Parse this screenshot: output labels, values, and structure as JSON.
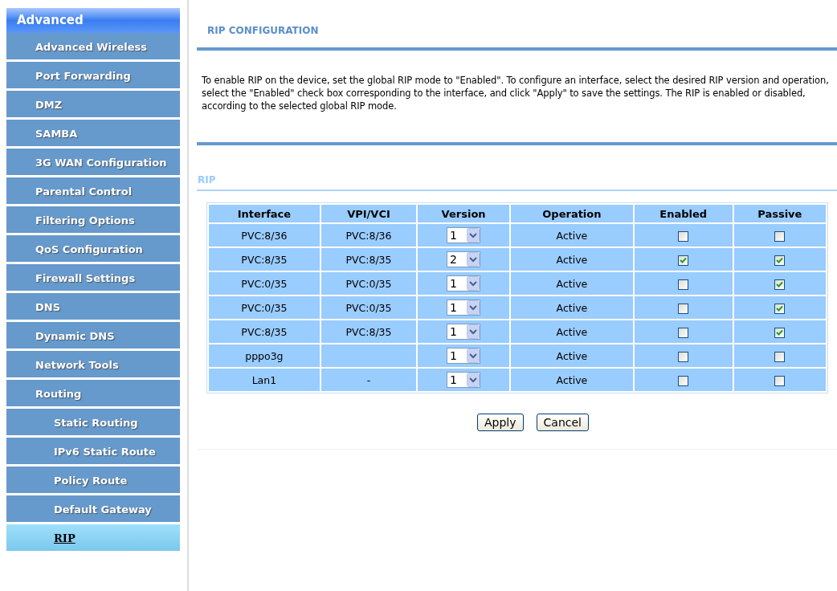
{
  "sidebar": {
    "header": "Advanced",
    "items": [
      {
        "label": "Advanced Wireless",
        "selected": false
      },
      {
        "label": "Port Forwarding",
        "selected": false
      },
      {
        "label": "DMZ",
        "selected": false
      },
      {
        "label": "SAMBA",
        "selected": false
      },
      {
        "label": "3G WAN Configuration",
        "selected": false
      },
      {
        "label": "Parental Control",
        "selected": false
      },
      {
        "label": "Filtering Options",
        "selected": false
      },
      {
        "label": "QoS Configuration",
        "selected": false
      },
      {
        "label": "Firewall Settings",
        "selected": false
      },
      {
        "label": "DNS",
        "selected": false
      },
      {
        "label": "Dynamic DNS",
        "selected": false
      },
      {
        "label": "Network Tools",
        "selected": false
      },
      {
        "label": "Routing",
        "selected": false,
        "children": [
          {
            "label": "Static Routing",
            "selected": false
          },
          {
            "label": "IPv6 Static Route",
            "selected": false
          },
          {
            "label": "Policy Route",
            "selected": false
          },
          {
            "label": "Default Gateway",
            "selected": false
          },
          {
            "label": "RIP",
            "selected": true
          }
        ]
      }
    ]
  },
  "main": {
    "title": "RIP CONFIGURATION",
    "description": "To enable RIP on the device, set the global RIP mode to \"Enabled\". To configure an interface, select the desired RIP version and operation, select the \"Enabled\" check box corresponding to the interface, and click \"Apply\" to save the settings. The RIP is enabled or disabled, according to the selected global RIP mode.",
    "section": "RIP",
    "table": {
      "columns": [
        "Interface",
        "VPI/VCI",
        "Version",
        "Operation",
        "Enabled",
        "Passive"
      ],
      "rows": [
        {
          "interface": "PVC:8/36",
          "vpi_vci": "PVC:8/36",
          "version": "1",
          "operation": "Active",
          "enabled": false,
          "passive": false
        },
        {
          "interface": "PVC:8/35",
          "vpi_vci": "PVC:8/35",
          "version": "2",
          "operation": "Active",
          "enabled": true,
          "passive": true
        },
        {
          "interface": "PVC:0/35",
          "vpi_vci": "PVC:0/35",
          "version": "1",
          "operation": "Active",
          "enabled": false,
          "passive": true
        },
        {
          "interface": "PVC:0/35",
          "vpi_vci": "PVC:0/35",
          "version": "1",
          "operation": "Active",
          "enabled": false,
          "passive": true
        },
        {
          "interface": "PVC:8/35",
          "vpi_vci": "PVC:8/35",
          "version": "1",
          "operation": "Active",
          "enabled": false,
          "passive": true
        },
        {
          "interface": "pppo3g",
          "version": "1",
          "operation": "Active",
          "enabled": false,
          "passive": false
        },
        {
          "interface": "Lan1",
          "vpi_vci": "-",
          "version": "1",
          "operation": "Active",
          "enabled": false,
          "passive": false
        }
      ]
    },
    "buttons": [
      "Apply",
      "Cancel"
    ]
  }
}
